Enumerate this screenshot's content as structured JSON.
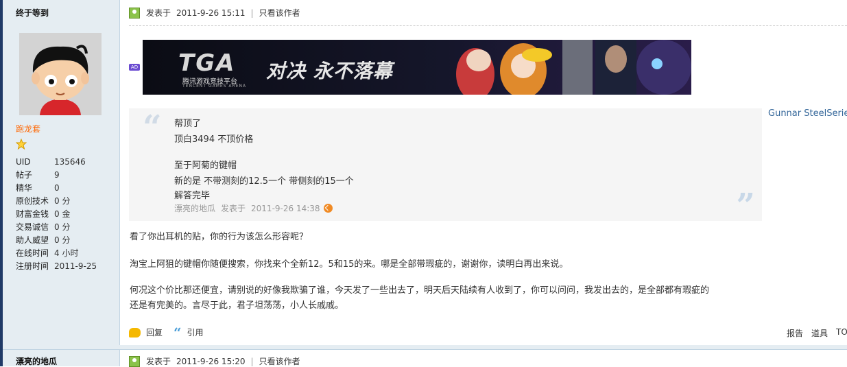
{
  "post1": {
    "author": "终于等到",
    "group": "跑龙套",
    "stats": [
      {
        "label": "UID",
        "value": "135646"
      },
      {
        "label": "帖子",
        "value": "9"
      },
      {
        "label": "精华",
        "value": "0"
      },
      {
        "label": "原创技术",
        "value": "0 分"
      },
      {
        "label": "财富金钱",
        "value": "0 金"
      },
      {
        "label": "交易诚信",
        "value": "0 分"
      },
      {
        "label": "助人威望",
        "value": "0 分"
      },
      {
        "label": "在线时间",
        "value": "4 小时"
      },
      {
        "label": "注册时间",
        "value": "2011-9-25"
      }
    ],
    "header": {
      "posted_label": "发表于",
      "time": "2011-9-26 15:11",
      "only_author": "只看该作者"
    },
    "ad": {
      "badge": "AD",
      "logo": "TGA",
      "logo_sub": "腾讯游戏竞技平台",
      "logo_sub_en": "TENCENT GAMES ARENA",
      "slogan": "对决 永不落幕"
    },
    "sponsor_link": "Gunnar SteelSerie",
    "quote": {
      "lines": [
        "帮顶了",
        "顶白3494 不顶价格",
        "至于阿菊的键帽",
        "新的是 不带测刻的12.5一个 带侧刻的15一个",
        "解答完毕"
      ],
      "author": "漂亮的地瓜",
      "posted_label": "发表于",
      "time": "2011-9-26 14:38"
    },
    "paragraphs": [
      "看了你出耳机的贴，你的行为该怎么形容呢？",
      "淘宝上阿狙的键帽你随便搜索，你找来个全新12。5和15的来。哪是全部带瑕疵的，谢谢你，读明白再出来说。",
      "何况这个价比那还便宜，请别说的好像我欺骗了谁，今天发了一些出去了，明天后天陆续有人收到了，你可以问问，我发出去的，是全部都有瑕疵的",
      "还是有完美的。言尽于此，君子坦荡荡，小人长戚戚。"
    ],
    "actions": {
      "reply": "回复",
      "quote": "引用"
    },
    "right_actions": [
      "报告",
      "道具",
      "TO"
    ]
  },
  "post2": {
    "author": "漂亮的地瓜",
    "header": {
      "posted_label": "发表于",
      "time": "2011-9-26 15:20",
      "only_author": "只看该作者"
    }
  }
}
